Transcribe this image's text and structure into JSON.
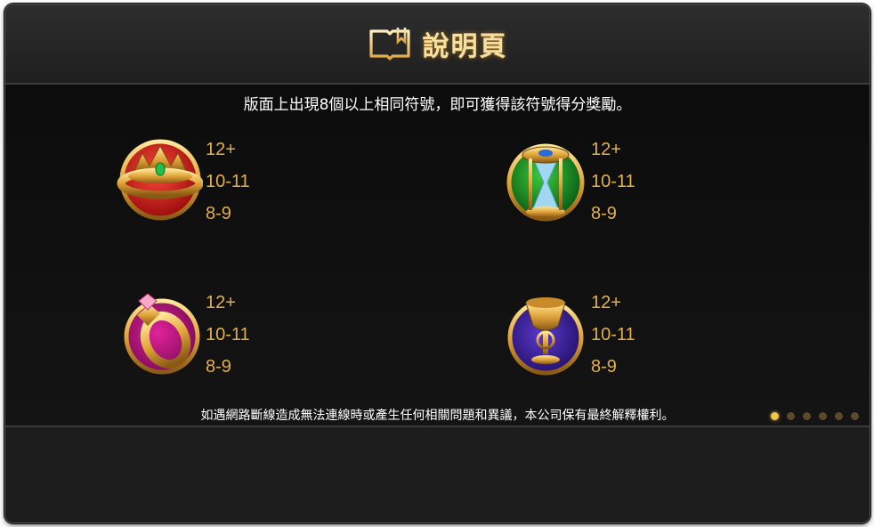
{
  "header": {
    "title": "說明頁",
    "icon": "book-icon"
  },
  "intro_text": "版面上出現8個以上相同符號，即可獲得該符號得分獎勵。",
  "symbols": [
    {
      "name": "crown",
      "icon": "crown-icon",
      "payouts": [
        "12+",
        "10-11",
        "8-9"
      ]
    },
    {
      "name": "hourglass",
      "icon": "hourglass-icon",
      "payouts": [
        "12+",
        "10-11",
        "8-9"
      ]
    },
    {
      "name": "ring",
      "icon": "ring-icon",
      "payouts": [
        "12+",
        "10-11",
        "8-9"
      ]
    },
    {
      "name": "chalice",
      "icon": "chalice-icon",
      "payouts": [
        "12+",
        "10-11",
        "8-9"
      ]
    }
  ],
  "disclaimer": "如遇網路斷線造成無法連線時或產生任何相關問題和異議，本公司保有最終解釋權利。",
  "pagination": {
    "total_pages": 6,
    "current_page": 1
  },
  "colors": {
    "accent_gold": "#e2b04a",
    "title_gold": "#f6dfa0",
    "background": "#161616"
  }
}
